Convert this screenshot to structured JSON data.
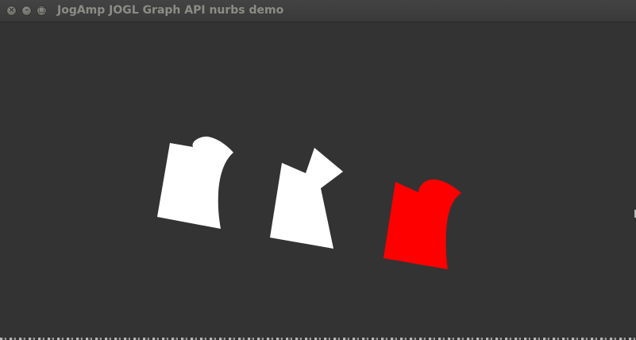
{
  "window": {
    "title": "JogAmp JOGL Graph API nurbs demo",
    "controls": {
      "close_glyph": "×",
      "minimize_glyph": "–",
      "maximize_glyph": "□"
    }
  },
  "scene": {
    "background_color": "#333333",
    "shapes": [
      {
        "name": "nurbs-shape-left",
        "color": "#ffffff"
      },
      {
        "name": "nurbs-shape-middle",
        "color": "#ffffff"
      },
      {
        "name": "nurbs-shape-right",
        "color": "#ff0000"
      }
    ]
  }
}
